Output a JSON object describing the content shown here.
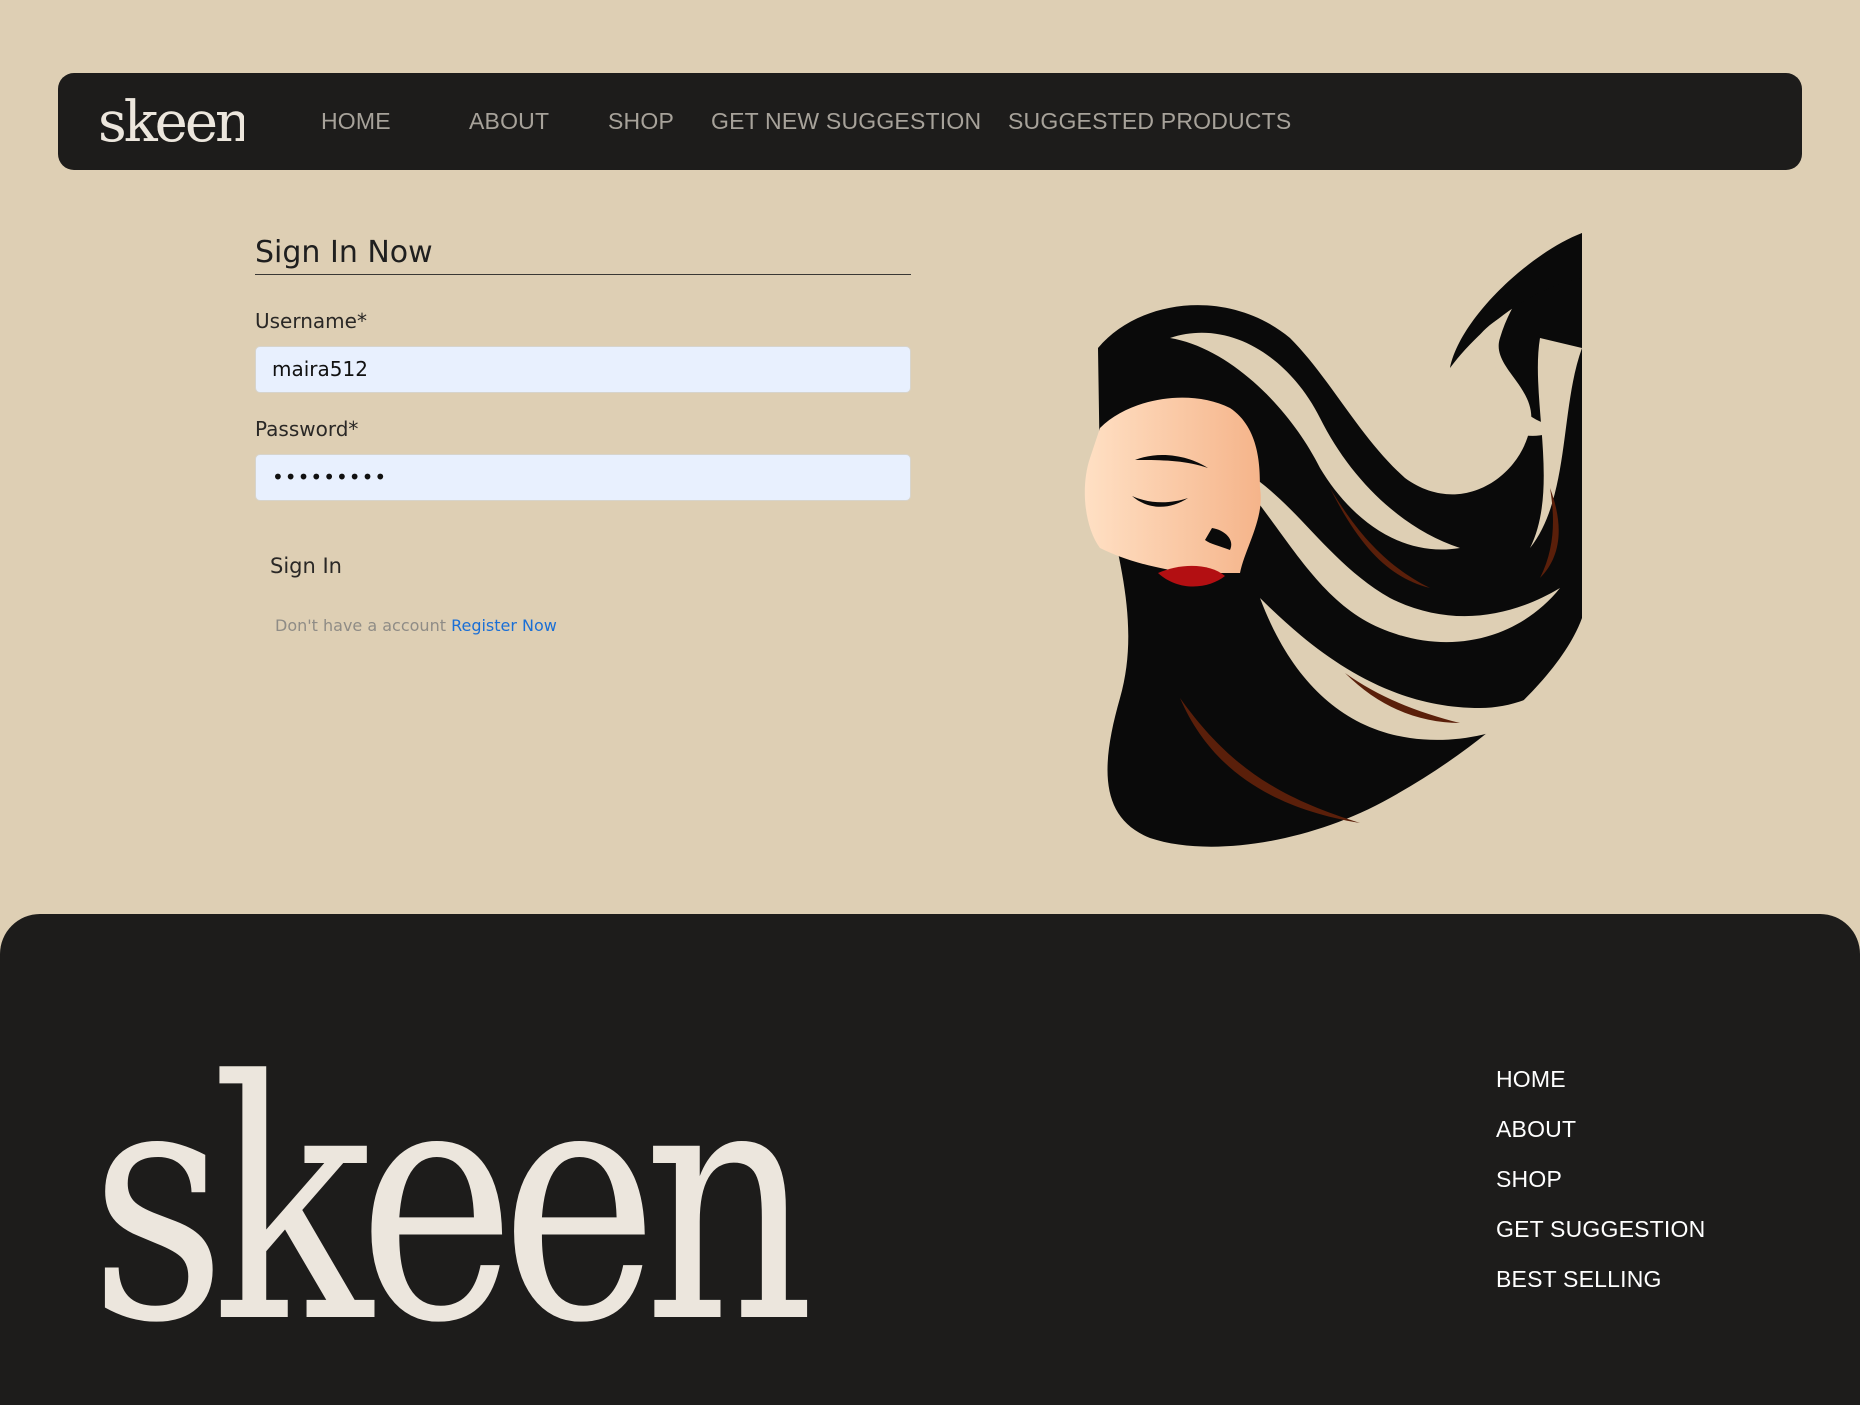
{
  "brand": {
    "name": "skeen"
  },
  "nav": {
    "items": [
      {
        "label": "HOME"
      },
      {
        "label": "ABOUT"
      },
      {
        "label": "SHOP"
      },
      {
        "label": "GET NEW SUGGESTION"
      },
      {
        "label": "SUGGESTED PRODUCTS"
      }
    ]
  },
  "signin": {
    "title": "Sign In Now",
    "username_label": "Username*",
    "username_value": "maira512",
    "password_label": "Password*",
    "password_value": "•••••••••",
    "submit_label": "Sign In",
    "register_prompt": "Don't have a account",
    "register_link": "Register Now"
  },
  "footer": {
    "links": [
      {
        "label": "HOME"
      },
      {
        "label": "ABOUT"
      },
      {
        "label": "SHOP"
      },
      {
        "label": "GET SUGGESTION"
      },
      {
        "label": "BEST SELLING"
      }
    ]
  },
  "icons": {
    "hero": "woman-flowing-hair-illustration"
  },
  "colors": {
    "page_background": "#decfb4",
    "bar_background": "#1d1c1b",
    "input_background": "#e8f0fe",
    "link": "#1a6fd6",
    "logo_fill": "#ece6dd"
  }
}
